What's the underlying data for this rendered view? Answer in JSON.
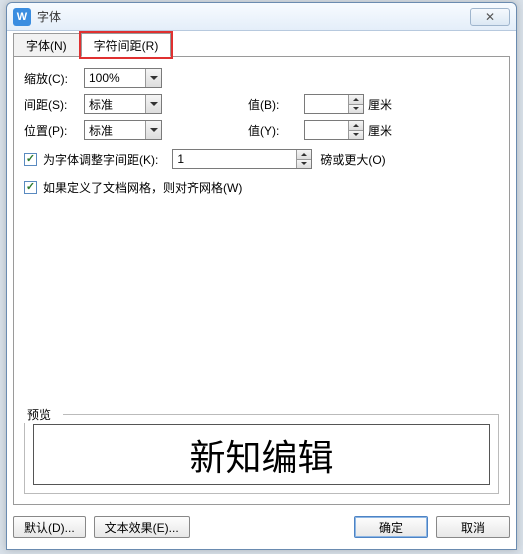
{
  "window": {
    "title": "字体"
  },
  "tabs": {
    "font": "字体(N)",
    "spacing": "字符间距(R)"
  },
  "form": {
    "scale_label": "缩放(C):",
    "scale_value": "100%",
    "spacing_label": "间距(S):",
    "spacing_value": "标准",
    "position_label": "位置(P):",
    "position_value": "标准",
    "valueB_label": "值(B):",
    "valueB_value": "",
    "valueY_label": "值(Y):",
    "valueY_value": "",
    "unit": "厘米",
    "kern_label": "为字体调整字间距(K):",
    "kern_value": "1",
    "kern_suffix": "磅或更大(O)",
    "snap_label": "如果定义了文档网格，则对齐网格(W)"
  },
  "preview": {
    "legend": "预览",
    "sample": "新知编辑"
  },
  "footer": {
    "default": "默认(D)...",
    "text_effects": "文本效果(E)...",
    "ok": "确定",
    "cancel": "取消"
  }
}
